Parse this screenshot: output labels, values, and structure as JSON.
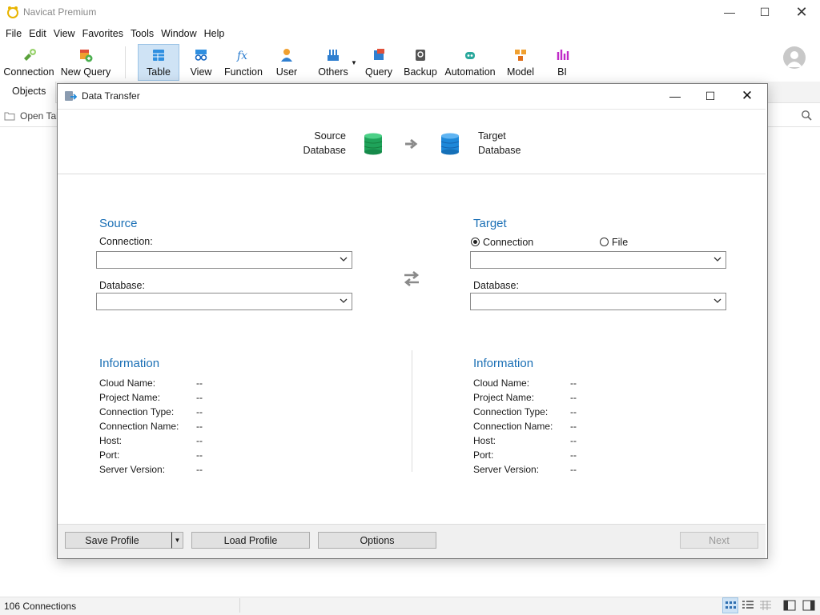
{
  "app": {
    "title": "Navicat Premium"
  },
  "menu": [
    "File",
    "Edit",
    "View",
    "Favorites",
    "Tools",
    "Window",
    "Help"
  ],
  "toolbar": {
    "connection": "Connection",
    "new_query": "New Query",
    "table": "Table",
    "view": "View",
    "function": "Function",
    "user": "User",
    "others": "Others",
    "query": "Query",
    "backup": "Backup",
    "automation": "Automation",
    "model": "Model",
    "bi": "BI"
  },
  "objects_tab": "Objects",
  "open_table": "Open Tab",
  "status": {
    "connections": "106 Connections"
  },
  "dialog": {
    "title": "Data Transfer",
    "header": {
      "source_l1": "Source",
      "source_l2": "Database",
      "target_l1": "Target",
      "target_l2": "Database"
    },
    "source": {
      "title": "Source",
      "connection_label": "Connection:",
      "connection_value": "",
      "database_label": "Database:",
      "database_value": ""
    },
    "target": {
      "title": "Target",
      "radio_connection": "Connection",
      "radio_file": "File",
      "selected": "Connection",
      "connection_value": "",
      "database_label": "Database:",
      "database_value": ""
    },
    "info_title": "Information",
    "info_labels": [
      "Cloud Name:",
      "Project Name:",
      "Connection Type:",
      "Connection Name:",
      "Host:",
      "Port:",
      "Server Version:"
    ],
    "source_info_values": [
      "--",
      "--",
      "--",
      "--",
      "--",
      "--",
      "--"
    ],
    "target_info_values": [
      "--",
      "--",
      "--",
      "--",
      "--",
      "--",
      "--"
    ],
    "buttons": {
      "save_profile": "Save Profile",
      "load_profile": "Load Profile",
      "options": "Options",
      "next": "Next"
    }
  },
  "colors": {
    "accent_blue": "#1a6fb5",
    "source_db": "#1fa35a",
    "target_db": "#1e88d9"
  }
}
